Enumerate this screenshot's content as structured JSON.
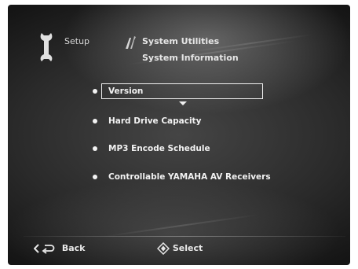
{
  "header": {
    "setup_label": "Setup",
    "breadcrumb_level1": "System Utilities",
    "breadcrumb_level2": "System Information"
  },
  "menu": {
    "items": [
      {
        "label": "Version",
        "selected": true
      },
      {
        "label": "Hard Drive Capacity",
        "selected": false
      },
      {
        "label": "MP3 Encode Schedule",
        "selected": false
      },
      {
        "label": "Controllable YAMAHA AV Receivers",
        "selected": false
      }
    ]
  },
  "footer": {
    "back_label": "Back",
    "select_label": "Select"
  },
  "icons": {
    "setup": "wrench-icon",
    "utilities": "tools-icon",
    "back": "back-return-icon",
    "select": "select-diamond-icon",
    "more": "down-arrow-icon"
  },
  "colors": {
    "background": "#2a2a2a",
    "text": "#f2f2f2",
    "highlight_border": "#f0f0f0"
  }
}
